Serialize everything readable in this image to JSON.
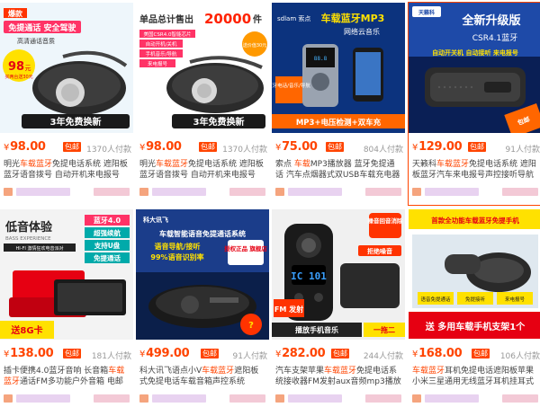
{
  "products": [
    {
      "img_text": {
        "l1": "爆款",
        "l2": "免提通话 安全驾驶",
        "l3": "高清通话音质",
        "price_tag": "98",
        "price_tag_unit": "元",
        "note": "买两台送30元",
        "banner": "3年免费换新"
      },
      "price": "98.00",
      "badge": "包邮",
      "sold": "1370人付款",
      "title_a": "明光",
      "title_hl": "车载蓝牙",
      "title_b": "免提电话系统 遮阳板蓝牙语音拨号 自动开机来电报号"
    },
    {
      "img_text": {
        "l1": "单品总计售出",
        "l2": "20000",
        "l3": "件",
        "list": [
          "美国CSR4.0智能芯片",
          "自动开机/关机",
          "手机音乐/导航",
          "来电报号"
        ],
        "price_tag": "送价值30元",
        "banner": "3年免费换新"
      },
      "price": "98.00",
      "badge": "包邮",
      "sold": "1370人付款",
      "title_a": "明光",
      "title_hl": "车载蓝牙",
      "title_b": "免提电话系统 遮阳板蓝牙语音拨号 自动开机来电报号"
    },
    {
      "img_text": {
        "brand": "sdlam 索点",
        "l1": "车载蓝牙MP3",
        "l2": "网络云音乐",
        "l3": "蓝牙电话/音乐/导航",
        "banner": "MP3+电压检测+双车充"
      },
      "price": "75.00",
      "badge": "包邮",
      "sold": "804人付款",
      "title_a": "索点 ",
      "title_hl": "车载",
      "title_b": "MP3播放器 蓝牙免提通话 汽车点烟器式双USB车载充电器"
    },
    {
      "img_text": {
        "brand": "天籁科",
        "l1": "全新升级版",
        "l2": "CSR4.1蓝牙",
        "l3": "自动开关机 自动接听 来电报号",
        "ribbon": "包邮"
      },
      "price": "129.00",
      "badge": "包邮",
      "sold": "91人付款",
      "title_a": "天籁科",
      "title_hl": "车载蓝牙",
      "title_b": "免提电话系统 遮阳板蓝牙汽车来电报号声控接听导航播报"
    },
    {
      "img_text": {
        "l1": "低音体验",
        "l2": "BASS EXPERIENCE",
        "l3": "HI-FI 激情狂欢电音派对",
        "side1": "蓝牙4.0",
        "side2": "超强续航",
        "side3": "支持U盘",
        "side4": "免提通话",
        "banner": "送8G卡"
      },
      "price": "138.00",
      "badge": "包邮",
      "sold": "181人付款",
      "title_a": "插卡便携4.0蓝牙音响 长音箱",
      "title_hl": "车载蓝牙",
      "title_b": "通话FM多功能户外音箱 电邮"
    },
    {
      "img_text": {
        "brand": "科大讯飞",
        "l1": "车载智能语音免提通话系统",
        "l2": "语音导航/接听",
        "l3": "99%语音识别率",
        "stamp": "授权正品 旗舰店"
      },
      "price": "499.00",
      "badge": "包邮",
      "sold": "91人付款",
      "title_a": "科大讯飞语点小V",
      "title_hl": "车载蓝牙",
      "title_b": "遮阳板式免提电话车载音箱声控系统"
    },
    {
      "img_text": {
        "stamp": "噪音回音消除",
        "display": "IC 101",
        "tag1": "拒绝噪音",
        "tag2": "FM 发射",
        "banner": "播放手机音乐",
        "banner2": "一拖二"
      },
      "price": "282.00",
      "badge": "包邮",
      "sold": "244人付款",
      "title_a": "汽车支架苹果",
      "title_hl": "车载蓝牙",
      "title_b": "免提电话系统接收器FM发射aux音频mp3播放机"
    },
    {
      "img_text": {
        "l1": "首款全功能车载蓝牙免提手机",
        "tags": [
          "语音免提通话",
          "免提接听",
          "来电报号"
        ],
        "banner": "送 多用车载手机支架1个"
      },
      "price": "168.00",
      "badge": "包邮",
      "sold": "106人付款",
      "title_a": "车载蓝牙",
      "title_hl": "",
      "title_b": "耳机免提电话遮阳板苹果小米三星通用无线蓝牙耳机挂耳式"
    }
  ],
  "colors": {
    "accent": "#ff4400",
    "blur1": "#f7c9b6",
    "blur2": "#dcd6f0",
    "blur3": "#f5c3d6"
  }
}
